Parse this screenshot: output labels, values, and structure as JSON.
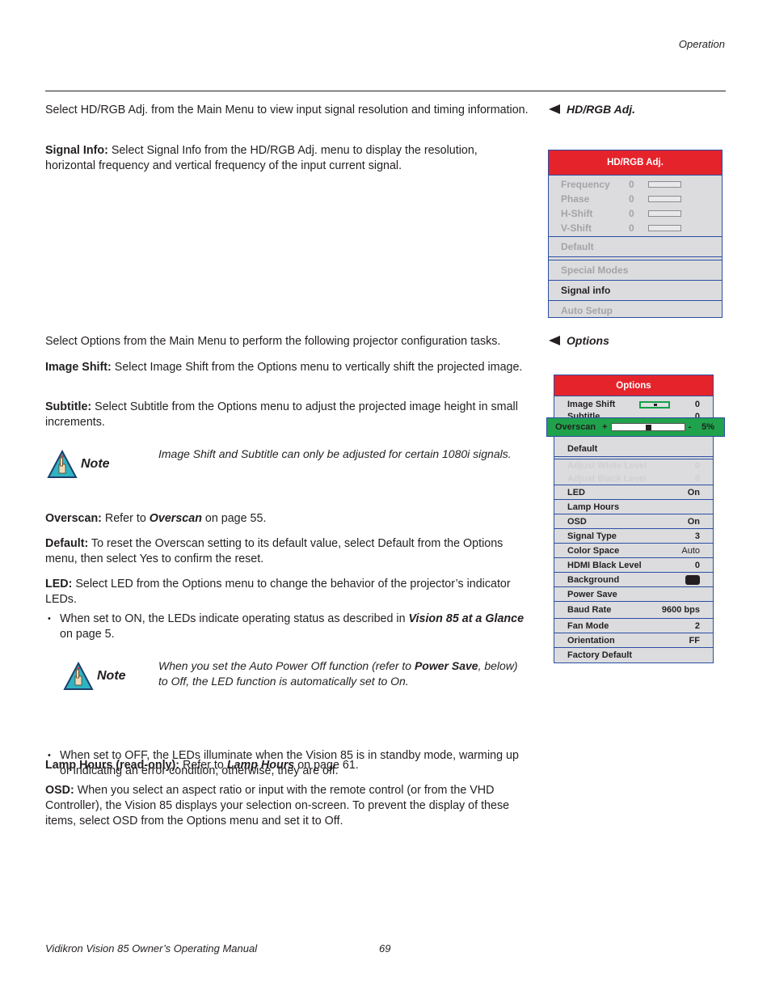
{
  "header": {
    "running_head": "Operation"
  },
  "sections": {
    "hd_rgb": {
      "side_heading": "HD/RGB Adj.",
      "intro": "Select HD/RGB Adj. from the Main Menu to view input signal resolution and timing information.",
      "signal_info": {
        "term": "Signal Info:",
        "text": " Select Signal Info from the HD/RGB Adj. menu to display the resolution, horizontal frequency and vertical frequency of the input current signal."
      }
    },
    "options": {
      "side_heading": "Options",
      "intro": "Select Options from the Main Menu to perform the following projector configuration tasks.",
      "image_shift": {
        "term": "Image Shift:",
        "text": " Select Image Shift from the Options menu to vertically shift the projected image."
      },
      "subtitle": {
        "term": "Subtitle:",
        "text": " Select Subtitle from the Options menu to adjust the projected image height in small increments."
      },
      "note1": {
        "label": "Note",
        "text": "Image Shift and Subtitle can only be adjusted for certain 1080i signals."
      },
      "overscan": {
        "term": "Overscan:",
        "pre": " Refer to ",
        "ref": "Overscan",
        "post": " on page 55."
      },
      "default": {
        "term": "Default:",
        "text": " To reset the Overscan setting to its default value, select Default from the Options menu, then select Yes to confirm the reset."
      },
      "led": {
        "term": "LED:",
        "text": " Select LED from the Options menu to change the behavior of the projector’s indicator LEDs."
      },
      "bullet_on": {
        "pre": "When set to ON, the LEDs indicate operating status as described in ",
        "ref": "Vision 85 at a Glance",
        "post": " on page 5."
      },
      "note2": {
        "label": "Note",
        "pre": "When you set the Auto Power Off function (refer to ",
        "ref": "Power Save",
        "post": ", below) to Off, the LED function is automatically set to On."
      },
      "bullet_off": {
        "text": "When set to OFF, the LEDs illuminate when the Vision 85 is in standby mode, warming up or indicating an error condition; otherwise, they are off."
      },
      "lamp_hours": {
        "term": "Lamp Hours (read-only):",
        "pre": " Refer to ",
        "ref": "Lamp Hours",
        "post": " on page 61."
      },
      "osd": {
        "term": "OSD:",
        "text": " When you select an aspect ratio or input with the remote control (or from the VHD Controller), the Vision 85 displays your selection on-screen. To prevent the display of these items, select OSD from the Options menu and set it to Off."
      }
    }
  },
  "hd_menu": {
    "title": "HD/RGB Adj.",
    "sliders": [
      {
        "label": "Frequency",
        "value": "0"
      },
      {
        "label": "Phase",
        "value": "0"
      },
      {
        "label": "H-Shift",
        "value": "0"
      },
      {
        "label": "V-Shift",
        "value": "0"
      }
    ],
    "items": [
      {
        "label": "Default"
      },
      {
        "label": "Special Modes"
      },
      {
        "label": "Signal info"
      },
      {
        "label": "Auto Setup"
      }
    ]
  },
  "options_menu": {
    "title": "Options",
    "image_shift": {
      "label": "Image Shift",
      "value": "0"
    },
    "subtitle": {
      "label": "Subtitle",
      "value": "0"
    },
    "overscan": {
      "label": "Overscan",
      "plus": "+",
      "minus": "-",
      "value": "5%"
    },
    "default": {
      "label": "Default"
    },
    "adjust_white": {
      "label": "Adjust White Level",
      "value": "0"
    },
    "adjust_black": {
      "label": "Adjust Black Level",
      "value": "0"
    },
    "rows": [
      {
        "label": "LED",
        "value": "On"
      },
      {
        "label": "Lamp Hours",
        "value": ""
      },
      {
        "label": "OSD",
        "value": "On"
      },
      {
        "label": "Signal Type",
        "value": "3"
      },
      {
        "label": "Color Space",
        "value": "Auto"
      },
      {
        "label": "HDMI Black Level",
        "value": "0"
      },
      {
        "label": "Background",
        "value": ""
      },
      {
        "label": "Power Save",
        "value": ""
      },
      {
        "label": "Baud Rate",
        "value": "9600 bps"
      },
      {
        "label": "Fan Mode",
        "value": "2"
      },
      {
        "label": "Orientation",
        "value": "FF"
      },
      {
        "label": "Factory Default",
        "value": ""
      }
    ],
    "colors": {
      "title_bg": "#e5232b",
      "highlight_bg": "#1fa24b",
      "menu_bg": "#dcdcde",
      "border": "#2b4ea3"
    }
  },
  "footer": {
    "manual_title": "Vidikron Vision 85 Owner’s Operating Manual",
    "page_number": "69"
  }
}
